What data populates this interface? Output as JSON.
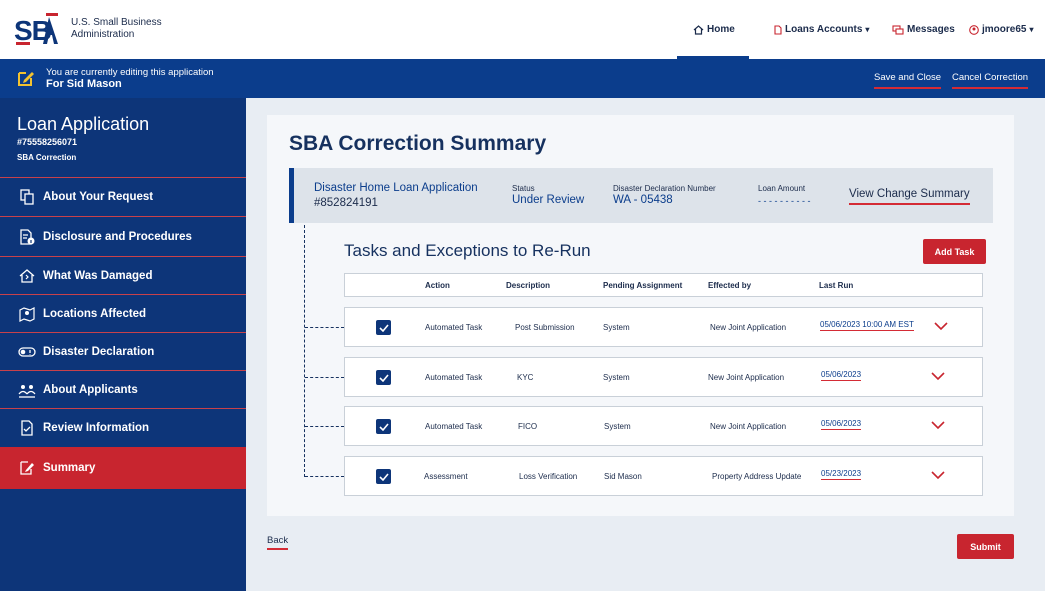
{
  "header": {
    "logo_text": "SBA",
    "org_line1": "U.S. Small Business",
    "org_line2": "Administration",
    "nav": {
      "home": "Home",
      "loans": "Loans Accounts",
      "messages": "Messages",
      "user": "jmoore65"
    }
  },
  "banner": {
    "line1": "You are currently editing this application",
    "line2": "For Sid Mason",
    "save_close": "Save and Close",
    "cancel": "Cancel Correction"
  },
  "sidebar": {
    "title": "Loan Application",
    "number": "#75558256071",
    "subtitle": "SBA Correction",
    "items": [
      {
        "label": "About Your Request",
        "icon": "copy-icon"
      },
      {
        "label": "Disclosure and Procedures",
        "icon": "document-info-icon"
      },
      {
        "label": "What Was Damaged",
        "icon": "house-damage-icon"
      },
      {
        "label": "Locations Affected",
        "icon": "map-pin-icon"
      },
      {
        "label": "Disaster Declaration",
        "icon": "toggle-alert-icon"
      },
      {
        "label": "About Applicants",
        "icon": "people-icon"
      },
      {
        "label": "Review Information",
        "icon": "document-check-icon"
      },
      {
        "label": "Summary",
        "icon": "edit-document-icon"
      }
    ]
  },
  "main": {
    "title": "SBA Correction Summary",
    "info": {
      "app_name": "Disaster Home Loan Application",
      "app_number": "#852824191",
      "status_label": "Status",
      "status_value": "Under Review",
      "decl_label": "Disaster Declaration Number",
      "decl_value": "WA - 05438",
      "amount_label": "Loan Amount",
      "amount_value": "- - - - - - - - - -",
      "view_change": "View Change Summary"
    },
    "tasks_title": "Tasks and Exceptions to Re-Run",
    "add_task": "Add Task",
    "columns": {
      "action": "Action",
      "description": "Description",
      "pending": "Pending Assignment",
      "effected": "Effected by",
      "last_run": "Last Run"
    },
    "rows": [
      {
        "action": "Automated Task",
        "description": "Post Submission",
        "pending": "System",
        "effected": "New Joint Application",
        "last_run": "05/06/2023 10:00 AM EST",
        "checked": true
      },
      {
        "action": "Automated Task",
        "description": "KYC",
        "pending": "System",
        "effected": "New Joint Application",
        "last_run": "05/06/2023",
        "checked": true
      },
      {
        "action": "Automated Task",
        "description": "FICO",
        "pending": "System",
        "effected": "New Joint Application",
        "last_run": "05/06/2023",
        "checked": true
      },
      {
        "action": "Assessment",
        "description": "Loss Verification",
        "pending": "Sid Mason",
        "effected": "Property Address Update",
        "last_run": "05/23/2023",
        "checked": true
      }
    ],
    "back": "Back",
    "submit": "Submit"
  },
  "colors": {
    "navy": "#0d3579",
    "primary_blue": "#0b3d8c",
    "accent_red": "#c8252f",
    "banner_icon_yellow": "#f2c230"
  }
}
